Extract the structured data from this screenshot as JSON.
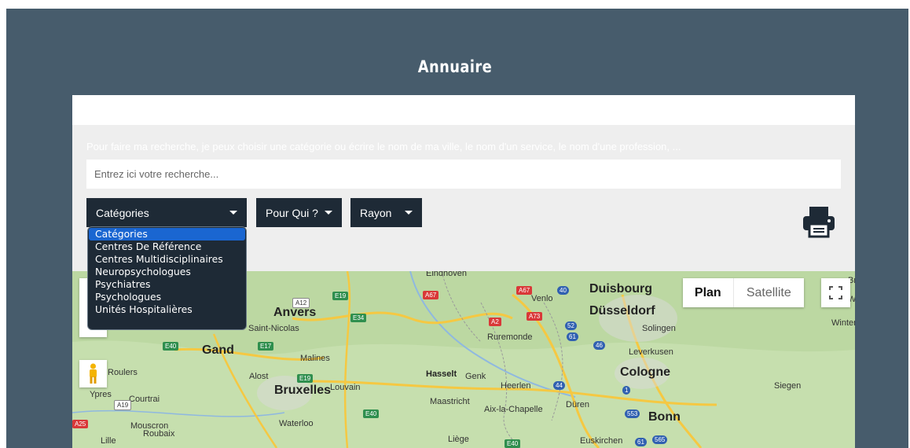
{
  "page": {
    "title": "Annuaire"
  },
  "search": {
    "hint": "Pour faire ma recherche, je peux choisir une catégorie ou écrire le nom de ma ville, le nom d'un service, le nom d'une profession, ...",
    "placeholder": "Entrez ici votre recherche...",
    "value": ""
  },
  "filters": {
    "categories_label": "Catégories",
    "pour_qui_label": "Pour Qui ?",
    "rayon_label": "Rayon"
  },
  "categories_dropdown": {
    "options": [
      "Catégories",
      "Centres De Référence",
      "Centres Multidisciplinaires",
      "Neuropsychologues",
      "Psychiatres",
      "Psychologues",
      "Unités Hospitalières"
    ],
    "selected": "Catégories"
  },
  "map": {
    "type_plan": "Plan",
    "type_satellite": "Satellite",
    "active_type": "Plan",
    "labels": {
      "eindhoven": "Eindhoven",
      "venlo": "Venlo",
      "duisbourg": "Duisbourg",
      "dusseldorf": "Düsseldorf",
      "solingen": "Solingen",
      "anvers": "Anvers",
      "saint_nicolas": "Saint-Nicolas",
      "gand": "Gand",
      "malines": "Malines",
      "ruremonde": "Ruremonde",
      "leverkusen": "Leverkusen",
      "cologne": "Cologne",
      "roulers": "Roulers",
      "alost": "Alost",
      "bruxelles": "Bruxelles",
      "louvain": "Louvain",
      "hasselt": "Hasselt",
      "genk": "Genk",
      "heerlen": "Heerlen",
      "siegen": "Siegen",
      "ypres": "Ypres",
      "courtrai": "Courtrai",
      "maastricht": "Maastricht",
      "aix": "Aix-la-Chapelle",
      "duren": "Düren",
      "bonn": "Bonn",
      "mouscron": "Mouscron",
      "roubaix": "Roubaix",
      "lille": "Lille",
      "waterloo": "Waterloo",
      "liege": "Liège",
      "euskirchen": "Euskirchen",
      "winter": "Winter",
      "w": "W",
      "br": "Br"
    },
    "road_shields": {
      "e19a": "E19",
      "a12": "A12",
      "e34": "E34",
      "a67": "A67",
      "a67b": "A67",
      "r40": "40",
      "a2": "A2",
      "a73": "A73",
      "r52": "52",
      "r61": "61",
      "e40a": "E40",
      "e17": "E17",
      "r46": "46",
      "e19b": "E19",
      "r44": "44",
      "r1": "1",
      "a19": "A19",
      "e40b": "E40",
      "r553": "553",
      "a25": "A25",
      "e40c": "E40",
      "r61b": "61",
      "r565": "565"
    }
  },
  "colors": {
    "header": "#475c6c",
    "panel": "#eeeeee",
    "dropdown": "#1e2a36",
    "selected_option": "#1a66d1",
    "map_land": "#bcd8a2"
  },
  "icons": {
    "print": "printer-icon",
    "fullscreen": "fullscreen-icon",
    "street_view": "pegman-icon",
    "caret": "caret-down-icon"
  }
}
